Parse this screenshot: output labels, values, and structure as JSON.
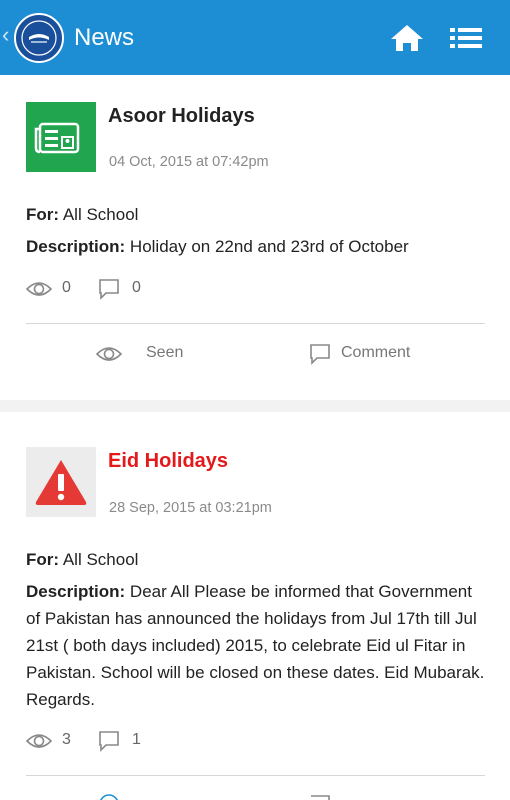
{
  "appbar": {
    "title": "News",
    "accent": "#1d8ed4",
    "icons": [
      "back-chevron-icon",
      "school-logo",
      "home-icon",
      "list-icon"
    ]
  },
  "posts": [
    {
      "title": "Asoor Holidays",
      "title_color": "#222222",
      "date": "04 Oct, 2015 at 07:42pm",
      "for_label": "For:",
      "for_value": " All School",
      "desc_label": "Description:",
      "desc_value": " Holiday on 22nd and 23rd of October",
      "views": "0",
      "comments": "0",
      "seen_label": "Seen",
      "comment_label": "Comment",
      "thumb_icon": "newspaper-icon",
      "thumb_color": "#22a54f"
    },
    {
      "title": "Eid Holidays",
      "title_color": "#e5181a",
      "date": "28 Sep, 2015 at 03:21pm",
      "for_label": "For:",
      "for_value": " All School",
      "desc_label": "Description:",
      "desc_value": " Dear All Please be informed that Government of Pakistan has announced the holidays from Jul 17th till Jul 21st ( both days included) 2015, to celebrate Eid ul Fitar in Pakistan. School will be closed on these dates. Eid Mubarak. Regards.",
      "views": "3",
      "comments": "1",
      "thumb_icon": "warning-icon"
    }
  ]
}
